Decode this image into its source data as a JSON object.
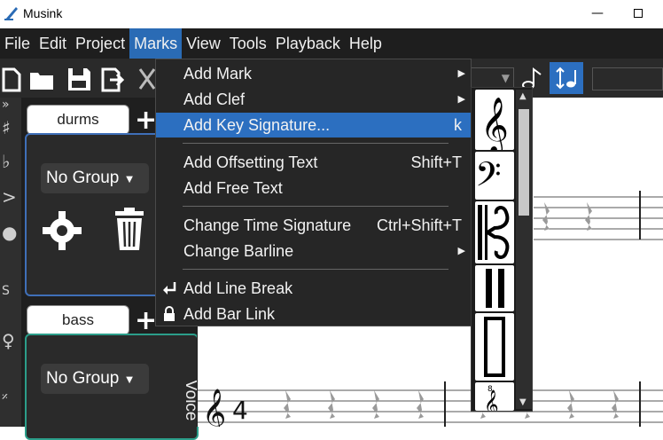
{
  "window": {
    "title": "Musink"
  },
  "menubar": {
    "items": [
      "File",
      "Edit",
      "Project",
      "Marks",
      "View",
      "Tools",
      "Playback",
      "Help"
    ],
    "active": "Marks"
  },
  "tracks": [
    {
      "name": "durms",
      "group": "No Group",
      "plus": "+"
    },
    {
      "name": "bass",
      "group": "No Group",
      "plus": "+",
      "voice_label": "Voice"
    }
  ],
  "marks_menu": {
    "items": [
      {
        "label": "Add Mark",
        "shortcut": "",
        "submenu": true
      },
      {
        "label": "Add Clef",
        "shortcut": "",
        "submenu": true
      },
      {
        "label": "Add Key Signature...",
        "shortcut": "k",
        "highlighted": true
      },
      {
        "label": "Add Offsetting Text",
        "shortcut": "Shift+T"
      },
      {
        "label": "Add Free Text",
        "shortcut": ""
      },
      {
        "label": "Change Time Signature",
        "shortcut": "Ctrl+Shift+T"
      },
      {
        "label": "Change Barline",
        "shortcut": "",
        "submenu": true
      },
      {
        "label": "Add Line Break",
        "shortcut": "",
        "icon": "line-break-icon"
      },
      {
        "label": "Add Bar Link",
        "shortcut": "",
        "icon": "lock-icon"
      }
    ]
  },
  "clef_submenu": {
    "items": [
      "treble-clef",
      "bass-clef",
      "alto-clef",
      "percussion-clef",
      "tab-clef",
      "treble-8vb-clef"
    ]
  },
  "colors": {
    "menu_bg": "#262626",
    "highlight": "#2c6fc0",
    "track1_border": "#3f6fb8",
    "track2_border": "#2b9e8a"
  }
}
